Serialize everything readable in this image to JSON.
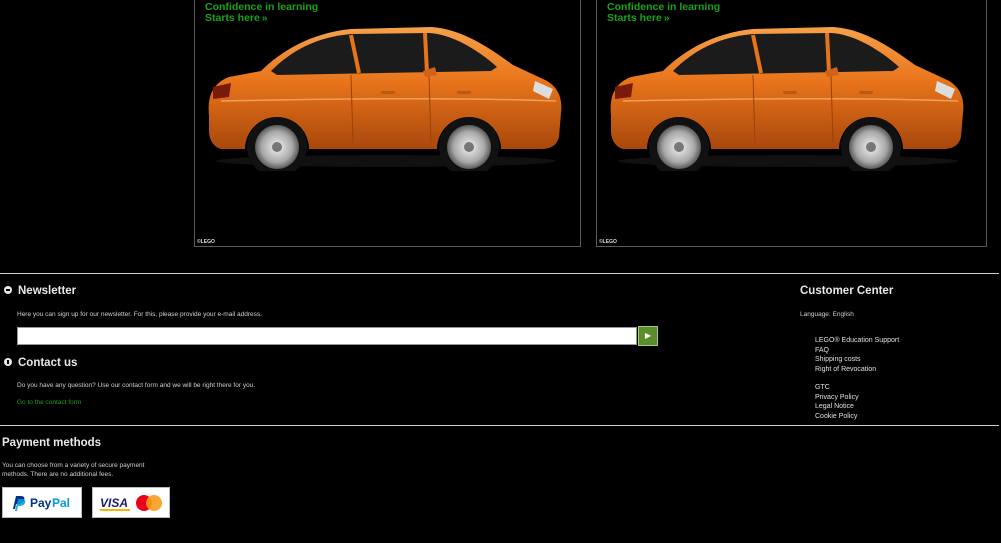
{
  "banners": [
    {
      "line1": "Confidence in learning",
      "line2": "Starts here",
      "copyright": "©LEGO"
    },
    {
      "line1": "Confidence in learning",
      "line2": "Starts here",
      "copyright": "©LEGO"
    }
  ],
  "newsletter": {
    "title": "Newsletter",
    "description": "Here you can sign up for our newsletter. For this, please provide your e-mail address.",
    "email_value": "",
    "submit_icon": "play-arrow-icon"
  },
  "contact": {
    "title": "Contact us",
    "description": "Do you have any question? Use our contact form and we will be right there for you.",
    "link": "Go to the contact form"
  },
  "customer_center": {
    "title": "Customer Center",
    "language": "Language: English",
    "links_group1": [
      "LEGO® Education Support",
      "FAQ",
      "Shipping costs",
      "Right of Revocation"
    ],
    "links_group2": [
      "GTC",
      "Privacy Policy",
      "Legal Notice",
      "Cookie Policy"
    ]
  },
  "payment": {
    "title": "Payment methods",
    "description": "You can choose from a variety of secure payment methods. There are no additional fees.",
    "methods": [
      "PayPal",
      "VISA"
    ]
  },
  "colors": {
    "accent_green": "#1aa31a",
    "button_green": "#5b8d2a",
    "car_orange": "#e8741a",
    "paypal_dark": "#003087",
    "paypal_light": "#009cde",
    "visa_blue": "#1a1f71",
    "mastercard_red": "#eb001b",
    "mastercard_orange": "#f79e1b"
  }
}
